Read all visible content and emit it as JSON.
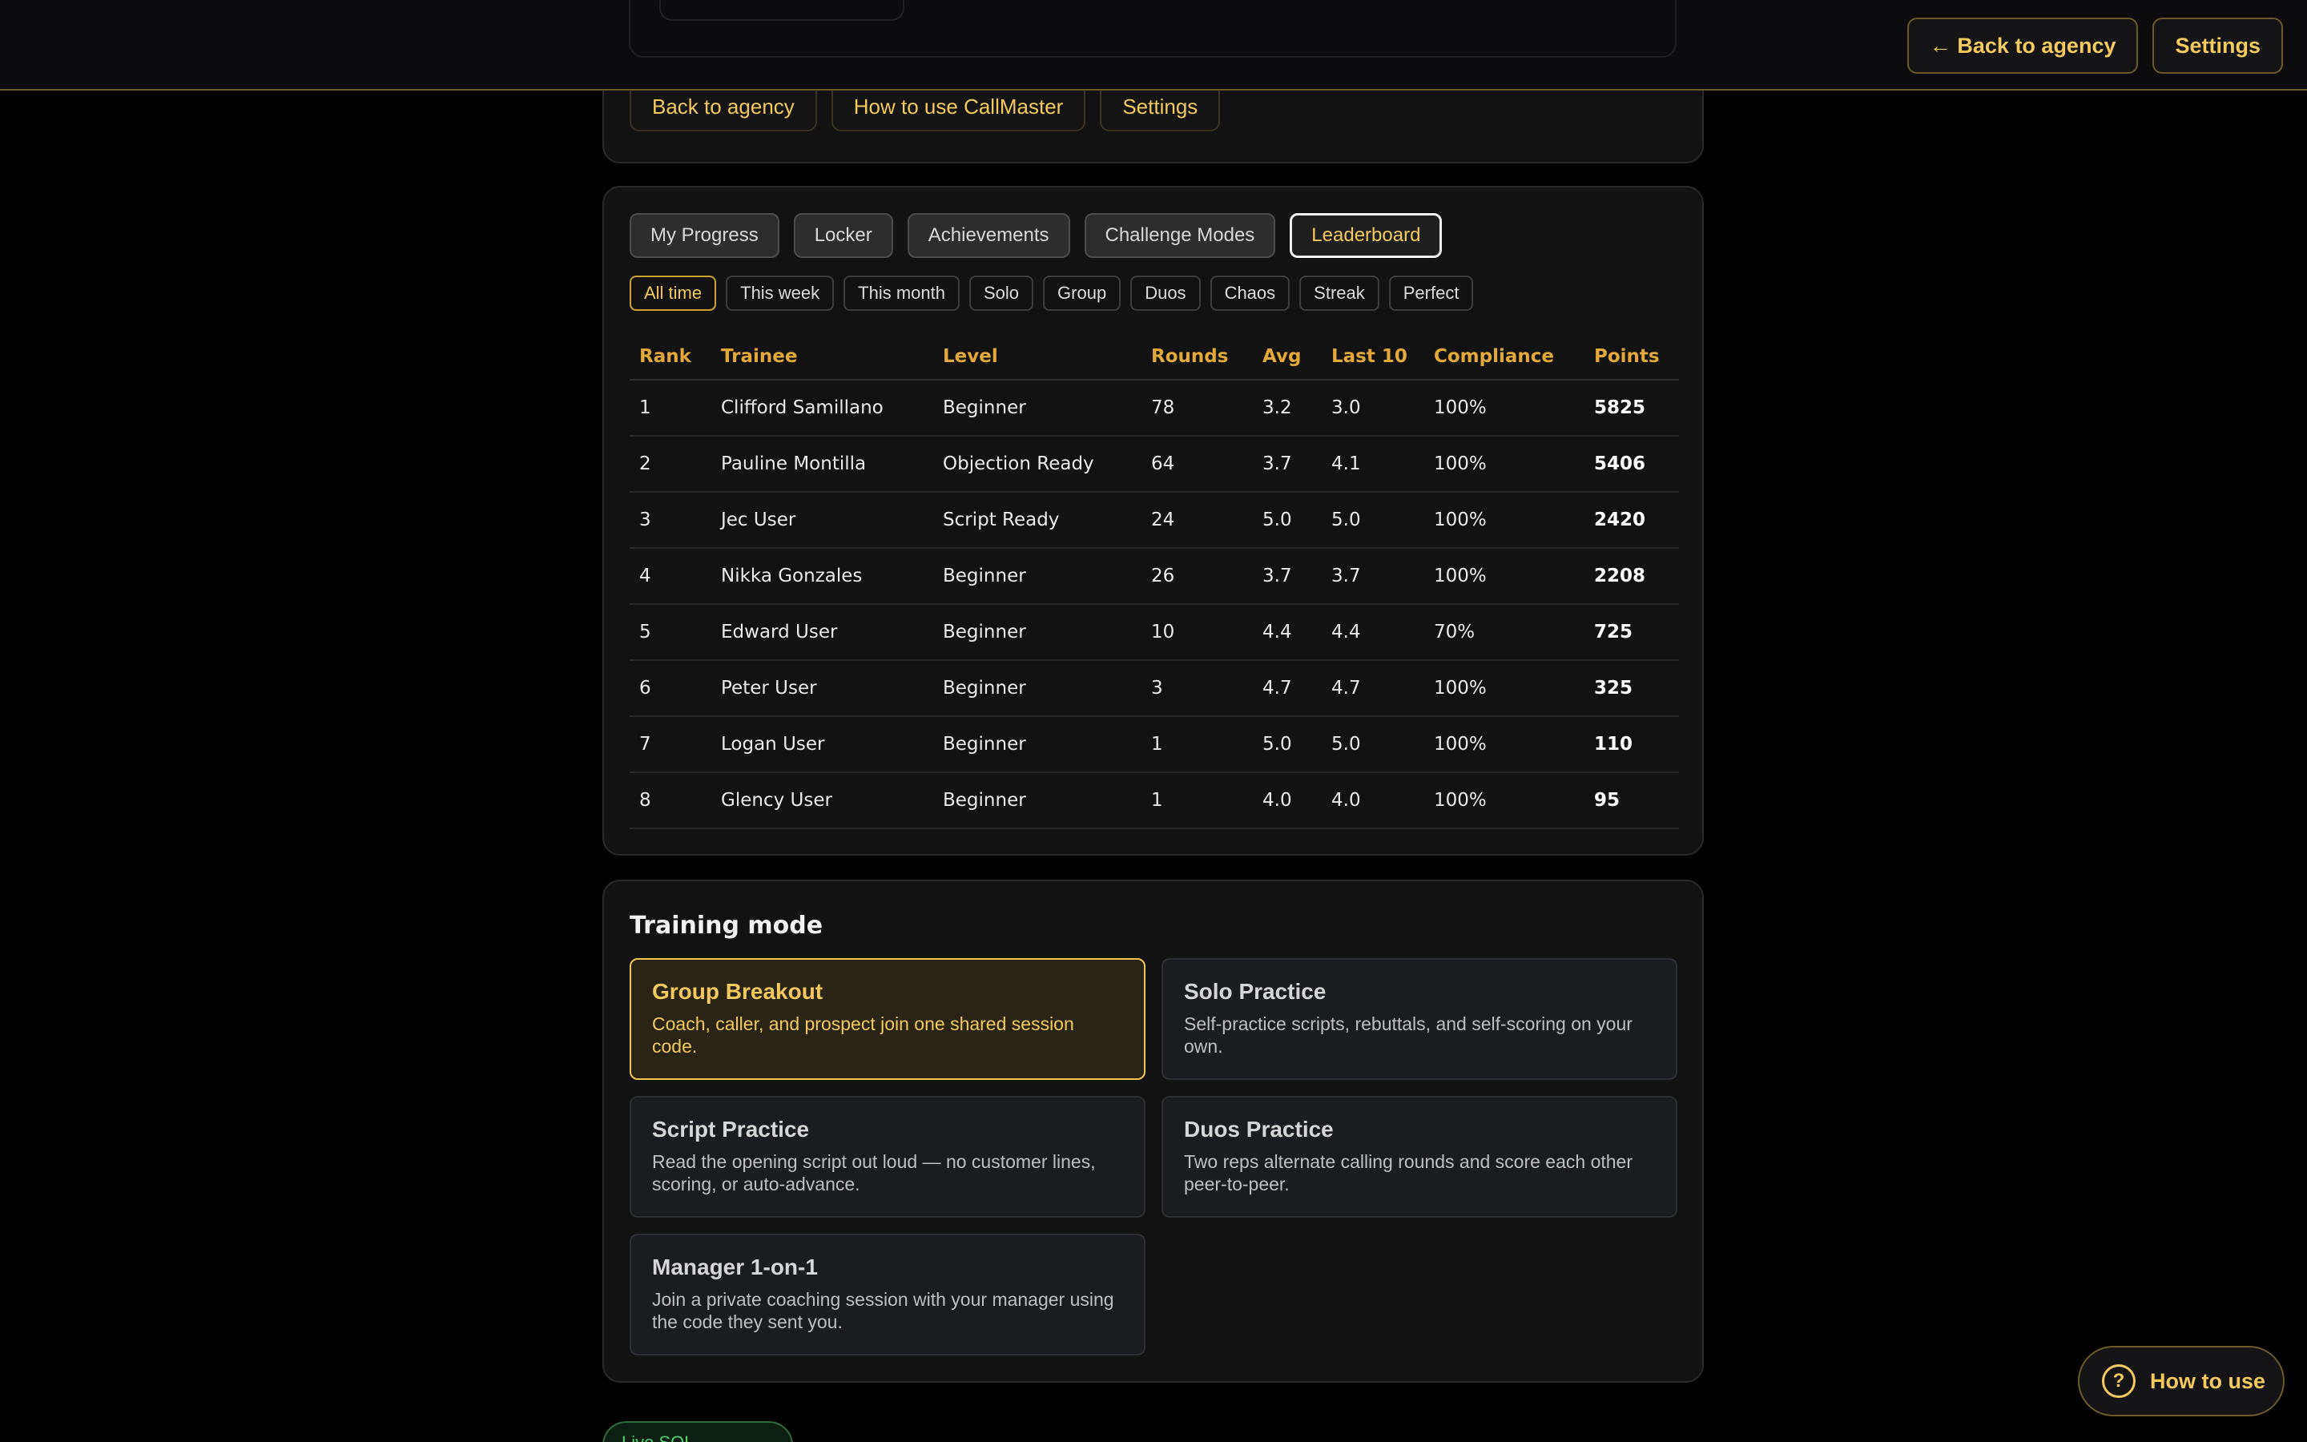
{
  "topbar": {
    "back_label": "← Back to agency",
    "settings_label": "Settings"
  },
  "nav": {
    "buttons": [
      "Back to agency",
      "How to use CallMaster",
      "Settings"
    ]
  },
  "tabs": [
    "My Progress",
    "Locker",
    "Achievements",
    "Challenge Modes",
    "Leaderboard"
  ],
  "active_tab": "Leaderboard",
  "filters": [
    "All time",
    "This week",
    "This month",
    "Solo",
    "Group",
    "Duos",
    "Chaos",
    "Streak",
    "Perfect"
  ],
  "active_filter": "All time",
  "leaderboard": {
    "columns": [
      "Rank",
      "Trainee",
      "Level",
      "Rounds",
      "Avg",
      "Last 10",
      "Compliance",
      "Points"
    ],
    "rows": [
      [
        "1",
        "Clifford Samillano",
        "Beginner",
        "78",
        "3.2",
        "3.0",
        "100%",
        "5825"
      ],
      [
        "2",
        "Pauline Montilla",
        "Objection Ready",
        "64",
        "3.7",
        "4.1",
        "100%",
        "5406"
      ],
      [
        "3",
        "Jec User",
        "Script Ready",
        "24",
        "5.0",
        "5.0",
        "100%",
        "2420"
      ],
      [
        "4",
        "Nikka Gonzales",
        "Beginner",
        "26",
        "3.7",
        "3.7",
        "100%",
        "2208"
      ],
      [
        "5",
        "Edward User",
        "Beginner",
        "10",
        "4.4",
        "4.4",
        "70%",
        "725"
      ],
      [
        "6",
        "Peter User",
        "Beginner",
        "3",
        "4.7",
        "4.7",
        "100%",
        "325"
      ],
      [
        "7",
        "Logan User",
        "Beginner",
        "1",
        "5.0",
        "5.0",
        "100%",
        "110"
      ],
      [
        "8",
        "Glency User",
        "Beginner",
        "1",
        "4.0",
        "4.0",
        "100%",
        "95"
      ]
    ]
  },
  "training": {
    "title": "Training mode",
    "modes": [
      {
        "title": "Group Breakout",
        "desc": "Coach, caller, and prospect join one shared session code.",
        "active": true
      },
      {
        "title": "Solo Practice",
        "desc": "Self-practice scripts, rebuttals, and self-scoring on your own.",
        "active": false
      },
      {
        "title": "Script Practice",
        "desc": "Read the opening script out loud — no customer lines, scoring, or auto-advance.",
        "active": false
      },
      {
        "title": "Duos Practice",
        "desc": "Two reps alternate calling rounds and score each other peer-to-peer.",
        "active": false
      },
      {
        "title": "Manager 1-on-1",
        "desc": "Join a private coaching session with your manager using the code they sent you.",
        "active": false
      }
    ]
  },
  "status": {
    "sql_label": "Live SQL connected"
  },
  "help": {
    "icon": "?",
    "label": "How to use"
  },
  "colors": {
    "accent": "#f4c95d",
    "header_text": "#e2a83a",
    "status_green": "#4fcf6b"
  }
}
